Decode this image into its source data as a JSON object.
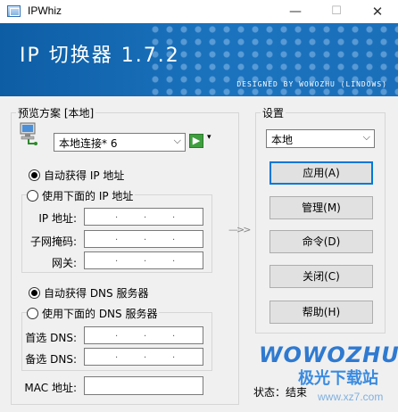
{
  "window": {
    "title": "IPWhiz",
    "min_glyph": "—",
    "max_glyph": "☐",
    "close_glyph": "✕"
  },
  "banner": {
    "title": "IP 切换器 1.7.2",
    "subtitle": "DESIGNED BY WOWOZHU (LINDOWS)"
  },
  "preview": {
    "legend": "预览方案 [本地]",
    "adapter_value": "本地连接* 6",
    "adapter_icon": "network-adapter-icon",
    "go_icon": "green-arrow-icon",
    "go_glyph": "▶",
    "dropdown_glyph": "▾",
    "auto_ip_label": "自动获得 IP 地址",
    "manual_ip_label": "使用下面的 IP 地址",
    "ip_label": "IP 地址:",
    "mask_label": "子网掩码:",
    "gateway_label": "网关:",
    "auto_dns_label": "自动获得 DNS 服务器",
    "manual_dns_label": "使用下面的 DNS 服务器",
    "dns1_label": "首选 DNS:",
    "dns2_label": "备选 DNS:",
    "mac_label": "MAC 地址:",
    "ip_dot": ".",
    "auto_ip_selected": true,
    "auto_dns_selected": true
  },
  "arrows": "—>>",
  "settings": {
    "legend": "设置",
    "scheme_value": "本地",
    "apply_label": "应用(A)",
    "manage_label": "管理(M)",
    "command_label": "命令(D)",
    "close_label": "关闭(C)",
    "help_label": "帮助(H)"
  },
  "status": {
    "text": "状态：结束"
  },
  "watermark": {
    "brand": "WOWOZHU",
    "site_cn": "极光下载站",
    "url": "www.xz7.com"
  },
  "colors": {
    "banner_blue": "#1b73be",
    "accent": "#0078d7"
  }
}
